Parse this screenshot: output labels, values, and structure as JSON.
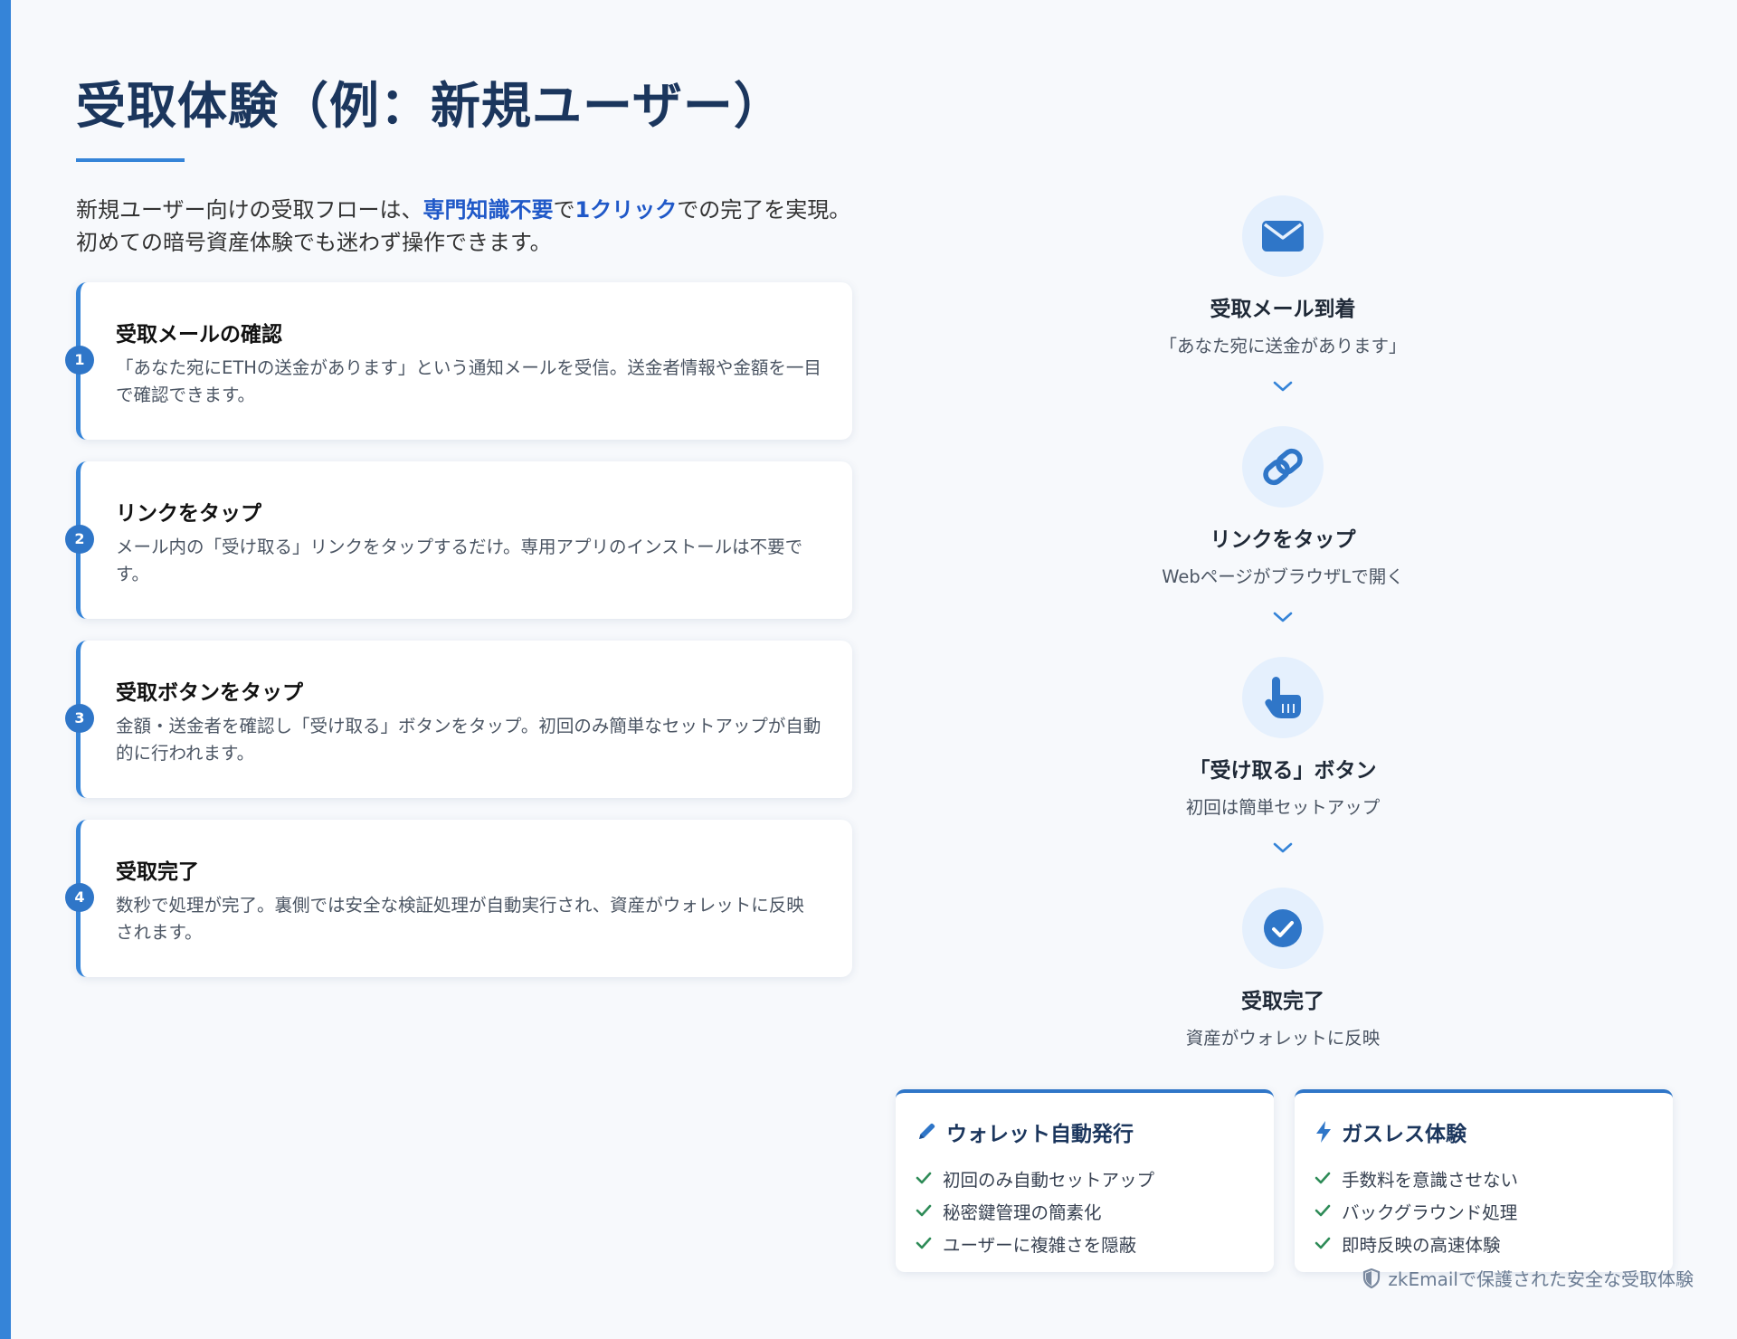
{
  "page": {
    "title": "受取体験（例：新規ユーザー）",
    "intro": {
      "p1": "新規ユーザー向けの受取フローは、",
      "em1": "専門知識不要",
      "p2": "で",
      "em2": "1クリック",
      "p3": "での完了を実現。",
      "line2": "初めての暗号資産体験でも迷わず操作できます。"
    }
  },
  "steps": [
    {
      "number": "1",
      "title": "受取メールの確認",
      "desc": "「あなた宛にETHの送金があります」という通知メールを受信。送金者情報や金額を一目で確認できます。"
    },
    {
      "number": "2",
      "title": "リンクをタップ",
      "desc": "メール内の「受け取る」リンクをタップするだけ。専用アプリのインストールは不要です。"
    },
    {
      "number": "3",
      "title": "受取ボタンをタップ",
      "desc": "金額・送金者を確認し「受け取る」ボタンをタップ。初回のみ簡単なセットアップが自動的に行われます。"
    },
    {
      "number": "4",
      "title": "受取完了",
      "desc": "数秒で処理が完了。裏側では安全な検証処理が自動実行され、資産がウォレットに反映されます。"
    }
  ],
  "flow": [
    {
      "icon": "envelope-icon",
      "title": "受取メール到着",
      "sub": "「あなた宛に送金があります」"
    },
    {
      "icon": "link-icon",
      "title": "リンクをタップ",
      "sub": "WebページがブラウザLで開く"
    },
    {
      "icon": "hand-pointer-icon",
      "title": "「受け取る」ボタン",
      "sub": "初回は簡単セットアップ"
    },
    {
      "icon": "check-circle-icon",
      "title": "受取完了",
      "sub": "資産がウォレットに反映"
    }
  ],
  "features": [
    {
      "icon": "pen-icon",
      "title": "ウォレット自動発行",
      "items": [
        "初回のみ自動セットアップ",
        "秘密鍵管理の簡素化",
        "ユーザーに複雑さを隠蔽"
      ]
    },
    {
      "icon": "bolt-icon",
      "title": "ガスレス体験",
      "items": [
        "手数料を意識させない",
        "バックグラウンド処理",
        "即時反映の高速体験"
      ]
    }
  ],
  "footer": {
    "icon": "shield-icon",
    "text": "zkEmailで保護された安全な受取体験"
  },
  "colors": {
    "accent": "#3584d8",
    "title": "#1b365d",
    "emphasis": "#1f58c8",
    "circle_bg": "#e5f0fd",
    "check": "#2e8b57"
  }
}
